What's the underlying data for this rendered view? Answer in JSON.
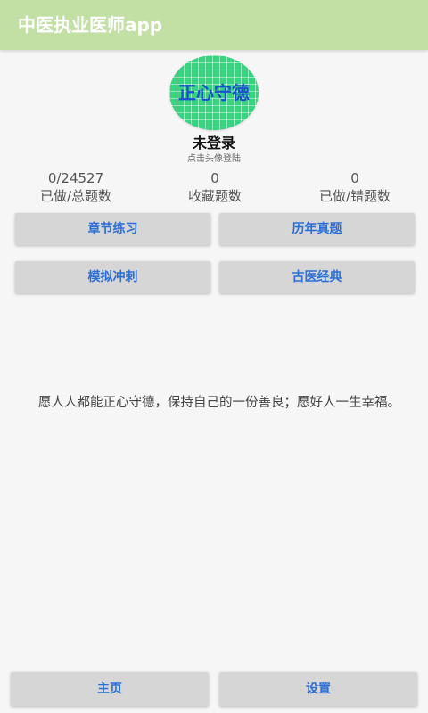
{
  "appbar": {
    "title": "中医执业医师app",
    "color": "#c2e0a3"
  },
  "avatar": {
    "text": "正心守德",
    "color": "#35d47f"
  },
  "login": {
    "status": "未登录",
    "hint": "点击头像登陆"
  },
  "stats": [
    {
      "value": "0/24527",
      "label": "已做/总题数"
    },
    {
      "value": "0",
      "label": "收藏题数"
    },
    {
      "value": "0",
      "label": "已做/错题数"
    }
  ],
  "menu": {
    "chapter_practice": "章节练习",
    "past_exams": "历年真题",
    "mock_sprint": "模拟冲刺",
    "ancient_classics": "古医经典"
  },
  "motto": "愿人人都能正心守德，保持自己的一份善良；愿好人一生幸福。",
  "bottom_nav": {
    "home": "主页",
    "settings": "设置"
  },
  "accent_color": "#2b6fd6"
}
